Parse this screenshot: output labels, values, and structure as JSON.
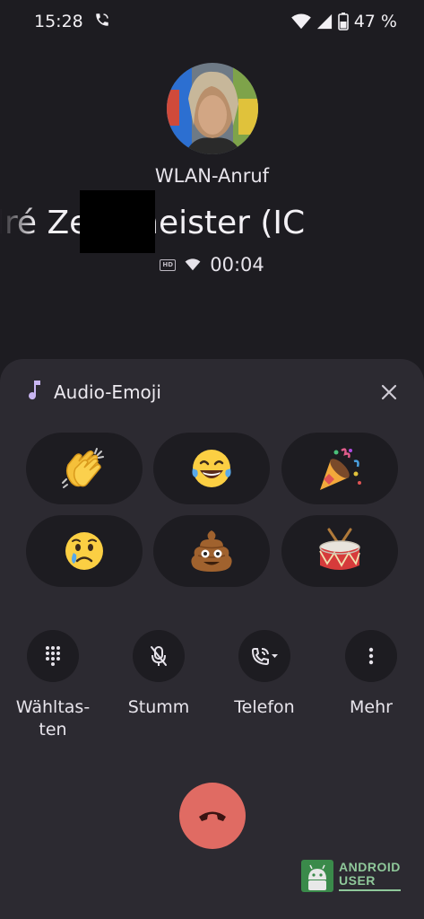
{
  "status_bar": {
    "time": "15:28",
    "battery": "47 %",
    "icons": [
      "wifi-call-icon",
      "wifi-icon",
      "signal-icon",
      "battery-icon"
    ]
  },
  "call": {
    "type": "WLAN-Anruf",
    "name": "dré Zechmeister (IC",
    "duration": "00:04",
    "icons": [
      "hd-icon",
      "wifi-small-icon"
    ]
  },
  "sheet": {
    "title": "Audio-Emoji",
    "emojis": [
      {
        "glyph": "👏",
        "name": "clapping-hands"
      },
      {
        "glyph": "😂",
        "name": "tears-of-joy"
      },
      {
        "glyph": "🎉",
        "name": "party-popper"
      },
      {
        "glyph": "😢",
        "name": "crying-face"
      },
      {
        "glyph": "💩",
        "name": "pile-of-poo"
      },
      {
        "glyph": "🥁",
        "name": "drum"
      }
    ]
  },
  "actions": {
    "keypad": "Wähltas-\nten",
    "mute": "Stumm",
    "phone": "Telefon",
    "more": "Mehr"
  },
  "watermark": {
    "line1": "ANDROID",
    "line2": "USER"
  },
  "colors": {
    "background": "#1d1c21",
    "sheet": "#2c2a31",
    "end_call": "#e06b63",
    "accent": "#c9b6f2"
  }
}
